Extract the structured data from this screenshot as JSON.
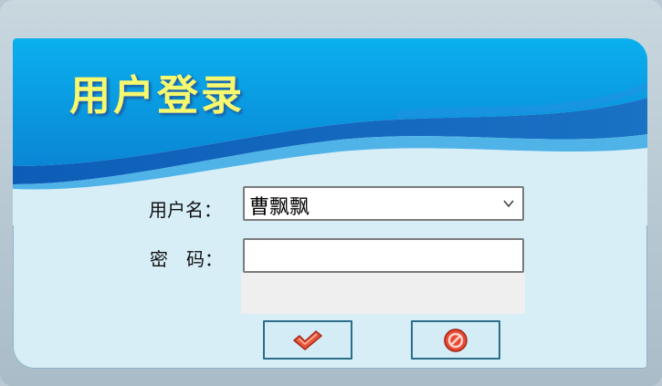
{
  "dialog": {
    "title": "用户登录"
  },
  "form": {
    "username_label": "用户名：",
    "username_value": "曹飘飘",
    "password_label": "密　码：",
    "password_value": ""
  },
  "buttons": {
    "confirm_icon": "check-icon",
    "cancel_icon": "no-entry-icon"
  },
  "colors": {
    "title": "#f6f86e",
    "banner_primary": "#0a8fd8",
    "banner_dark": "#0f5fb6",
    "panel_background": "#d7eef7",
    "button_border": "#2c6d8a"
  }
}
